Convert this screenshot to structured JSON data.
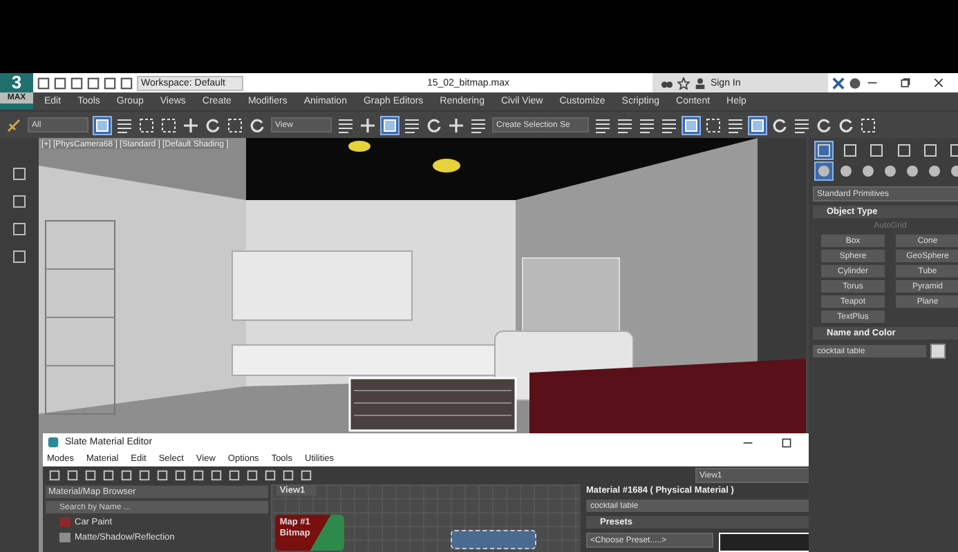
{
  "title_bar": {
    "logo": "3",
    "logo_caption": "MAX",
    "workspace": "Workspace: Default",
    "file_name": "15_02_bitmap.max",
    "sign_in": "Sign In"
  },
  "menu_bar": [
    "Edit",
    "Tools",
    "Group",
    "Views",
    "Create",
    "Modifiers",
    "Animation",
    "Graph Editors",
    "Rendering",
    "Civil View",
    "Customize",
    "Scripting",
    "Content",
    "Help"
  ],
  "toolbar": {
    "selection_filter": "All",
    "reference_coordinate": "View",
    "named_selection": "Create Selection Se"
  },
  "viewport": {
    "label": "[+] [PhysCamera68 ] [Standard ] [Default Shading ]"
  },
  "command_panel": {
    "category": "Standard Primitives",
    "object_type": {
      "title": "Object Type",
      "autogrid": "AutoGrid",
      "buttons": [
        "Box",
        "Cone",
        "Sphere",
        "GeoSphere",
        "Cylinder",
        "Tube",
        "Torus",
        "Pyramid",
        "Teapot",
        "Plane",
        "TextPlus"
      ]
    },
    "name_and_color": {
      "title": "Name and Color",
      "name": "cocktail table"
    }
  },
  "material_editor": {
    "title": "Slate Material Editor",
    "menu": [
      "Modes",
      "Material",
      "Edit",
      "Select",
      "View",
      "Options",
      "Tools",
      "Utilities"
    ],
    "browser": {
      "title": "Material/Map Browser",
      "search_placeholder": "Search by Name ...",
      "items": [
        {
          "name": "Car Paint",
          "color": "#8a2a2a"
        },
        {
          "name": "Matte/Shadow/Reflection",
          "color": "#8c8c8c"
        }
      ]
    },
    "view_tab": "View1",
    "node": {
      "title": "Map #1",
      "subtitle": "Bitmap"
    },
    "view_dropdown": "View1",
    "material_title": "Material #1684  ( Physical Material )",
    "material_name": "cocktail table",
    "presets": {
      "title": "Presets",
      "choose": "<Choose Preset.....>"
    }
  }
}
